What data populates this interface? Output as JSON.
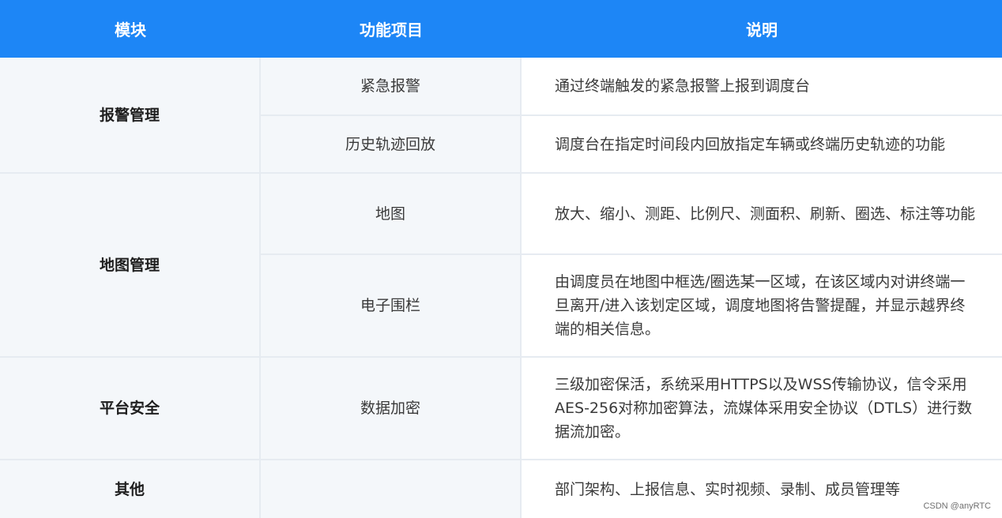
{
  "header": {
    "module": "模块",
    "feature": "功能项目",
    "description": "说明"
  },
  "rows": [
    {
      "module": "报警管理"
    },
    {
      "feature": "紧急报警",
      "description": "通过终端触发的紧急报警上报到调度台"
    },
    {
      "feature": "历史轨迹回放",
      "description": "调度台在指定时间段内回放指定车辆或终端历史轨迹的功能"
    },
    {
      "module": "地图管理"
    },
    {
      "feature": "地图",
      "description": "放大、缩小、测距、比例尺、测面积、刷新、圈选、标注等功能"
    },
    {
      "feature": "电子围栏",
      "description": "由调度员在地图中框选/圈选某一区域，在该区域内对讲终端一旦离开/进入该划定区域，调度地图将告警提醒，并显示越界终端的相关信息。"
    },
    {
      "module": "平台安全",
      "feature": "数据加密",
      "description": "三级加密保活，系统采用HTTPS以及WSS传输协议，信令采用AES-256对称加密算法，流媒体采用安全协议（DTLS）进行数据流加密。"
    },
    {
      "module": "其他",
      "feature": "",
      "description": "部门架构、上报信息、实时视频、录制、成员管理等"
    }
  ],
  "watermark": "CSDN @anyRTC"
}
